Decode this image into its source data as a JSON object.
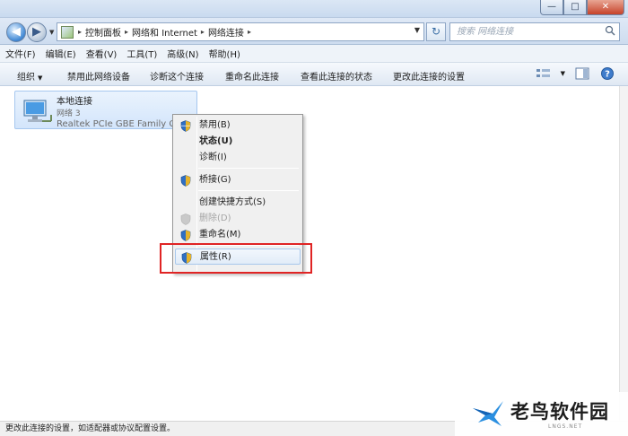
{
  "window": {
    "minimize_label": "—",
    "maximize_label": "□",
    "close_label": "✕"
  },
  "address": {
    "breadcrumbs": [
      "控制面板",
      "网络和 Internet",
      "网络连接"
    ],
    "search_placeholder": "搜索 网络连接"
  },
  "menubar": {
    "items": [
      "文件(F)",
      "编辑(E)",
      "查看(V)",
      "工具(T)",
      "高级(N)",
      "帮助(H)"
    ]
  },
  "commandbar": {
    "organize": "组织",
    "commands": [
      "禁用此网络设备",
      "诊断这个连接",
      "重命名此连接",
      "查看此连接的状态",
      "更改此连接的设置"
    ]
  },
  "connection": {
    "name": "本地连接",
    "network": "网络 3",
    "device": "Realtek PCIe GBE Family Co"
  },
  "context_menu": {
    "items": [
      {
        "label": "禁用(B)",
        "icon": "shield-icon"
      },
      {
        "label": "状态(U)",
        "bold": true
      },
      {
        "label": "诊断(I)"
      },
      {
        "label": "桥接(G)",
        "icon": "shield-icon"
      },
      {
        "label": "创建快捷方式(S)"
      },
      {
        "label": "删除(D)",
        "icon": "shield-icon",
        "disabled": true
      },
      {
        "label": "重命名(M)",
        "icon": "shield-icon"
      },
      {
        "label": "属性(R)",
        "icon": "shield-icon",
        "highlighted": true
      }
    ]
  },
  "statusbar": {
    "text": "更改此连接的设置，如适配器或协议配置设置。"
  },
  "watermark": {
    "name": "老鸟软件园",
    "sub": "LNGS.NET"
  },
  "colors": {
    "highlight_box": "#e02424",
    "selection_blue": "#a6c7ef"
  }
}
